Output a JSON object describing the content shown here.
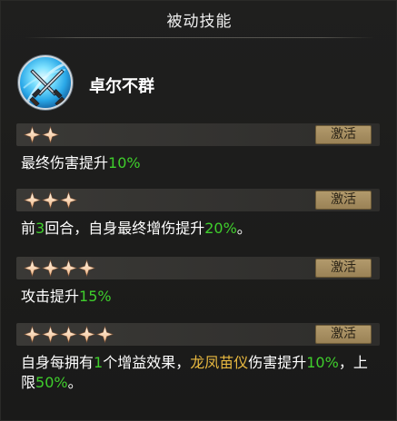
{
  "panel_title": "被动技能",
  "skill": {
    "name": "卓尔不群",
    "icon": "crossed-blades-icon"
  },
  "activate_label": "激活",
  "tiers": [
    {
      "stars": 2,
      "parts": [
        {
          "t": "最终伤害提升"
        },
        {
          "t": "10%",
          "c": "g"
        }
      ]
    },
    {
      "stars": 3,
      "parts": [
        {
          "t": "前"
        },
        {
          "t": "3",
          "c": "g"
        },
        {
          "t": "回合，自身最终增伤提升"
        },
        {
          "t": "20%",
          "c": "g"
        },
        {
          "t": "。"
        }
      ]
    },
    {
      "stars": 4,
      "parts": [
        {
          "t": "攻击提升"
        },
        {
          "t": "15%",
          "c": "g"
        }
      ]
    },
    {
      "stars": 5,
      "parts": [
        {
          "t": "自身每拥有"
        },
        {
          "t": "1",
          "c": "g"
        },
        {
          "t": "个增益效果，"
        },
        {
          "t": "龙凤苗仪",
          "c": "y"
        },
        {
          "t": "伤害提升"
        },
        {
          "t": "10%",
          "c": "g"
        },
        {
          "t": "，上限"
        },
        {
          "t": "50%",
          "c": "g"
        },
        {
          "t": "。"
        }
      ]
    }
  ],
  "colors": {
    "highlight_green": "#3fce2c",
    "highlight_gold": "#e9b940",
    "button_gold": "#b29a6c"
  }
}
